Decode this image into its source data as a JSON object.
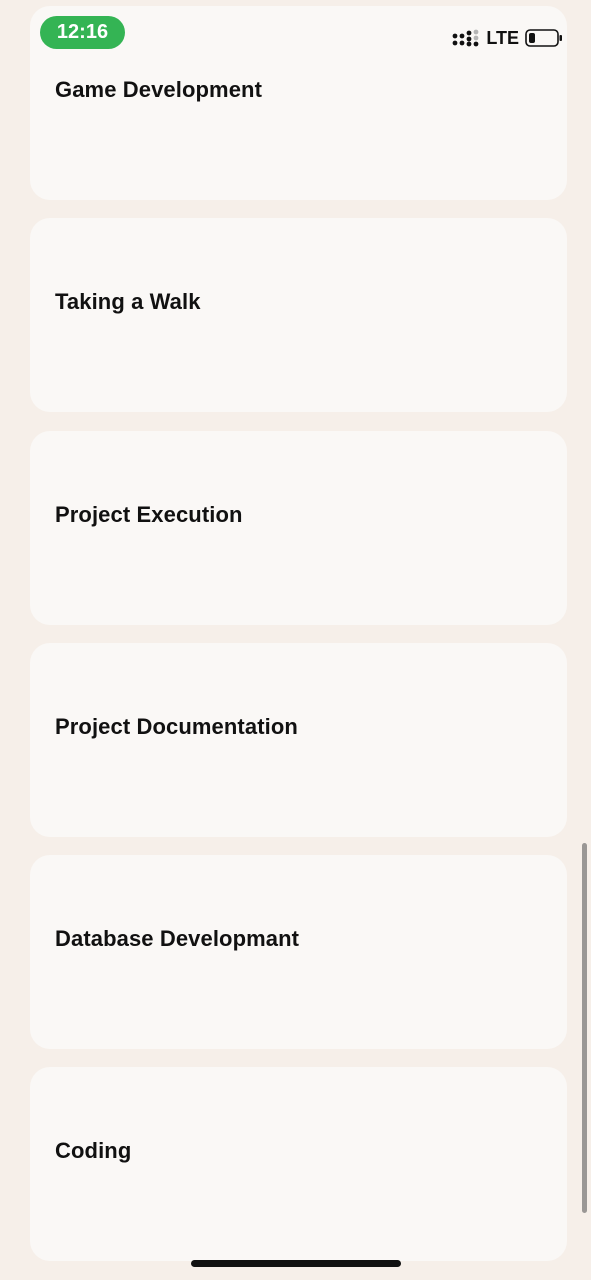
{
  "status_bar": {
    "time": "12:16",
    "network": "LTE",
    "time_pill_color": "#34b454",
    "signal_icon": "signal-icon",
    "battery_icon": "battery-icon"
  },
  "colors": {
    "background": "#f6efe9",
    "card": "#faf8f6",
    "text": "#111111"
  },
  "list": {
    "items": [
      {
        "label": "Game Development"
      },
      {
        "label": "Taking a Walk"
      },
      {
        "label": "Project Execution"
      },
      {
        "label": "Project Documentation"
      },
      {
        "label": "Database Developmant"
      },
      {
        "label": "Coding"
      }
    ]
  }
}
